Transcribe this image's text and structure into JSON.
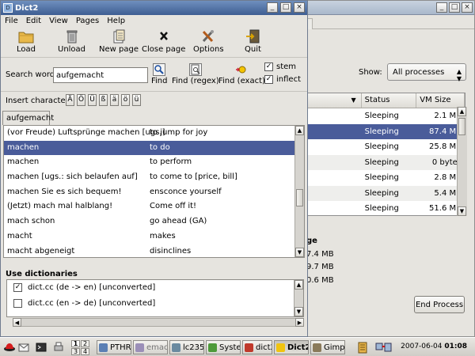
{
  "background_window": {
    "show_label": "Show:",
    "show_value": "All processes",
    "columns": [
      "Status",
      "VM Size"
    ],
    "rows": [
      {
        "status": "Sleeping",
        "vm": "2.1 MB",
        "selected": false
      },
      {
        "status": "Sleeping",
        "vm": "87.4 MB",
        "selected": true
      },
      {
        "status": "Sleeping",
        "vm": "25.8 MB",
        "selected": false
      },
      {
        "status": "Sleeping",
        "vm": "0 bytes",
        "selected": false
      },
      {
        "status": "Sleeping",
        "vm": "2.8 MB",
        "selected": false
      },
      {
        "status": "Sleeping",
        "vm": "5.4 MB",
        "selected": false
      },
      {
        "status": "Sleeping",
        "vm": "51.6 MB",
        "selected": false
      }
    ],
    "memory_title": "ge",
    "memory_values": [
      "7.4 MB",
      "9.7 MB",
      "0.6 MB"
    ],
    "end_process_label": "End Process"
  },
  "window": {
    "title": "Dict2",
    "menu": [
      "File",
      "Edit",
      "View",
      "Pages",
      "Help"
    ],
    "toolbar": {
      "load": "Load",
      "unload": "Unload",
      "new_page": "New page",
      "close_page": "Close page",
      "options": "Options",
      "quit": "Quit"
    },
    "search": {
      "label": "Search word:",
      "value": "aufgemacht",
      "find": "Find",
      "find_regex": "Find (regex)",
      "find_exact": "Find (exact)",
      "stem": "stem",
      "inflect": "inflect",
      "stem_checked": true,
      "inflect_checked": true
    },
    "insert": {
      "label": "Insert character:",
      "chars": [
        "Ä",
        "Ö",
        "Ü",
        "ß",
        "ä",
        "ö",
        "ü"
      ]
    },
    "result_tab": "aufgemacht",
    "results": [
      {
        "de": "(vor Freude) Luftsprünge machen [ugs.]",
        "en": "to jump for joy",
        "selected": false
      },
      {
        "de": "machen",
        "en": "to do",
        "selected": true
      },
      {
        "de": "machen",
        "en": "to perform",
        "selected": false
      },
      {
        "de": "machen [ugs.: sich belaufen auf]",
        "en": "to come to [price, bill]",
        "selected": false
      },
      {
        "de": "machen Sie es sich bequem!",
        "en": "ensconce yourself",
        "selected": false
      },
      {
        "de": "(Jetzt) mach mal halblang!",
        "en": "Come off it!",
        "selected": false
      },
      {
        "de": "mach schon",
        "en": "go ahead (GA)",
        "selected": false
      },
      {
        "de": "macht",
        "en": "makes",
        "selected": false
      },
      {
        "de": "macht abgeneigt",
        "en": "disinclines",
        "selected": false
      }
    ],
    "dictionaries_title": "Use dictionaries",
    "dictionaries": [
      {
        "name": "dict.cc (de -> en) [unconverted]",
        "checked": true
      },
      {
        "name": "dict.cc (en -> de) [unconverted]",
        "checked": false
      }
    ]
  },
  "taskbar": {
    "desktops": [
      "1",
      "2",
      "3",
      "4"
    ],
    "tasks": [
      "PTHR",
      "emac",
      "lc235",
      "Syste",
      "dict2",
      "Dict2",
      "Gimp"
    ],
    "active_task": "Dict2",
    "date": "2007-06-04",
    "time": "01:08"
  }
}
